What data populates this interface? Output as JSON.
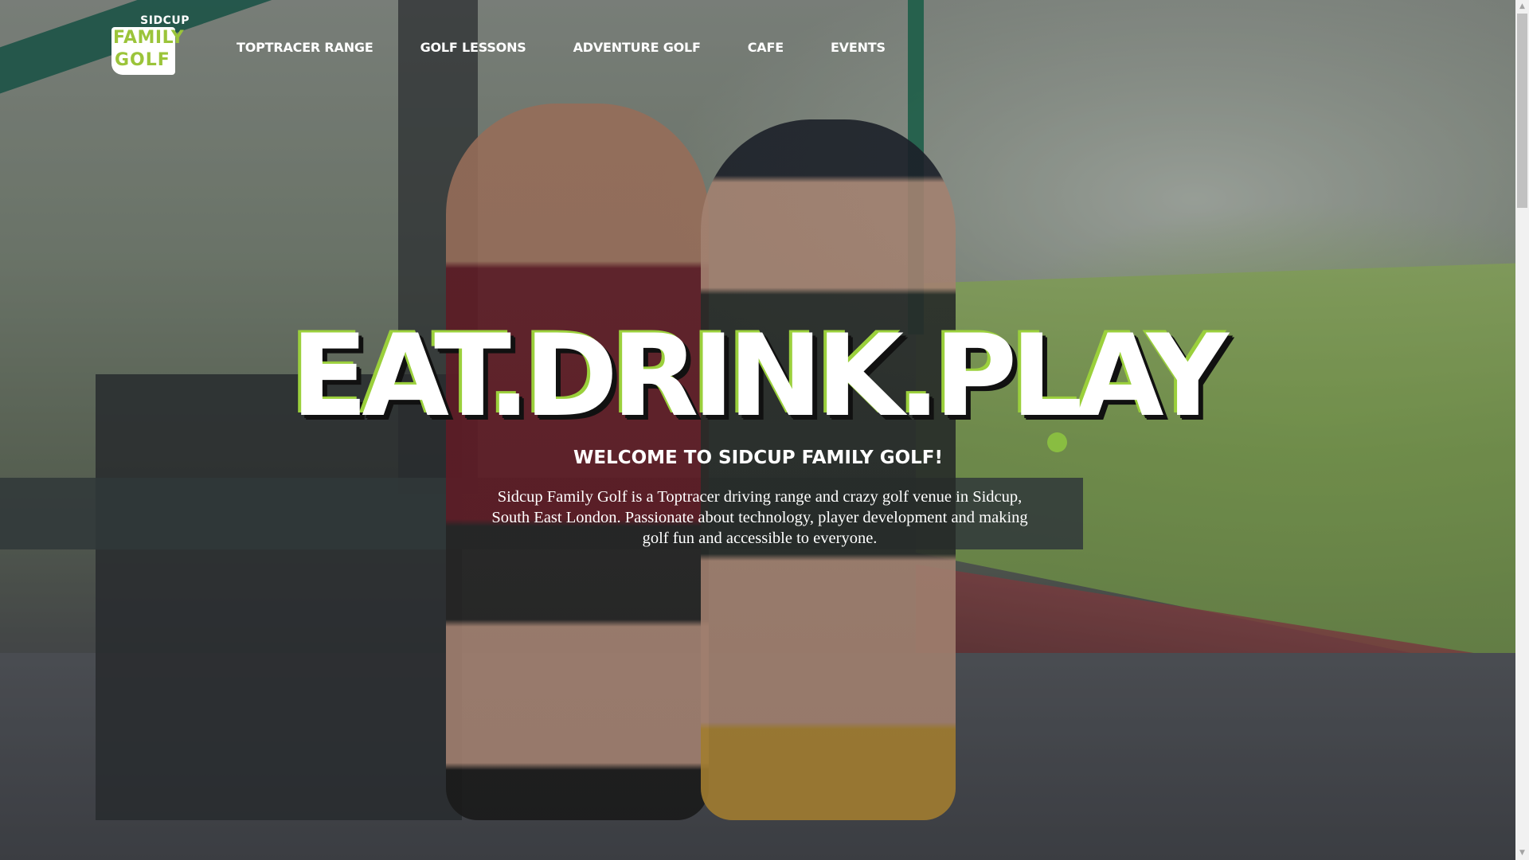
{
  "logo": {
    "top_text": "SIDCUP",
    "line1": "FAMILY",
    "line2": "GOLF",
    "brand_color": "#9bc43a"
  },
  "nav": {
    "items": [
      {
        "label": "TOPTRACER RANGE"
      },
      {
        "label": "GOLF LESSONS"
      },
      {
        "label": "ADVENTURE GOLF"
      },
      {
        "label": "CAFE"
      },
      {
        "label": "EVENTS"
      }
    ]
  },
  "hero": {
    "title": "EAT.DRINK.PLAY",
    "subtitle": "WELCOME TO SIDCUP FAMILY GOLF!",
    "description": "Sidcup Family Golf is a Toptracer driving range and crazy golf venue in Sidcup, South East London. Passionate about technology, player development and making golf fun and accessible to everyone.",
    "accent_color": "#9bd03c"
  },
  "scrollbar": {
    "up_icon": "scroll-up-arrow-icon",
    "down_icon": "scroll-down-arrow-icon"
  }
}
